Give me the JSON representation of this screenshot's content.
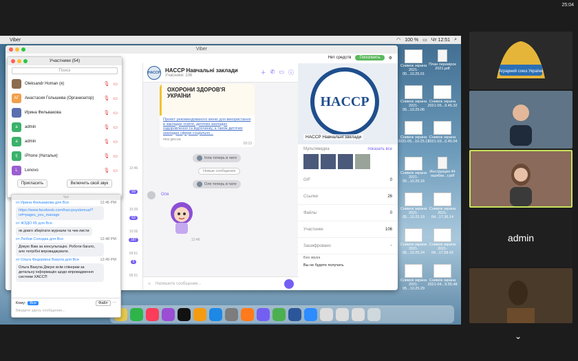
{
  "clock": "25:04",
  "menubar": {
    "app": "Viber",
    "battery": "100 %",
    "time": "Чт 12:51"
  },
  "viber": {
    "window_title": "Viber",
    "top_status": "Нет средств",
    "topup_label": "Пополнить",
    "chat": {
      "name": "HACCP Навчальні заклади",
      "subtitle": "Учасники: 106",
      "post_heading": "ОХОРОНИ ЗДОРОВ'Я УКРАЇНИ",
      "post_link": "Проект рекомендованого меню для використання в закладах освіти, дитячих закладах оздоровлення та відпочинку, а також дитячих закладах сфери соціально...",
      "post_source": "moz.gov.ua",
      "post_time": "09:23",
      "sys1": "Inna теперь в чате",
      "new_messages": "Новые сообщения",
      "sys2": "Оля теперь в чате",
      "sender": "Оля",
      "sticker_time": "12:46",
      "compose_placeholder": "Напишите сообщение..."
    },
    "list_times": [
      "12:46",
      "10:39",
      "10:06",
      "09:51",
      "09:31"
    ],
    "list_badges": [
      "59",
      "63",
      "187",
      "5"
    ],
    "info": {
      "cover_title": "HACCP Навчальні заклади",
      "media_label": "Мультимедиа",
      "show_all": "показать все",
      "gif_label": "GIF",
      "gif_count": "0",
      "links_label": "Ссылки",
      "links_count": "26",
      "files_label": "Файлы",
      "files_count": "0",
      "members_label": "Участники",
      "members_count": "106",
      "encrypted_label": "Зашифровано",
      "mute_label": "Без звука",
      "mute_desc": "Вы не будете получать"
    }
  },
  "participants": {
    "title": "Участники (54)",
    "search_placeholder": "Поиск",
    "items": [
      {
        "name": "Oleksandr Homan (я)",
        "initial": "",
        "color": "#8c6b4f"
      },
      {
        "name": "Анастасия Голышева (Организатор)",
        "initial": "АГ",
        "color": "#f0a04b"
      },
      {
        "name": "Ирина Фильвакова",
        "initial": "",
        "color": "#5b6fb0"
      },
      {
        "name": "admin",
        "initial": "a",
        "color": "#3ab26b"
      },
      {
        "name": "admin",
        "initial": "a",
        "color": "#3ab26b"
      },
      {
        "name": "iPhone (Наталья)",
        "initial": "i(",
        "color": "#3ab26b"
      },
      {
        "name": "Lenovo",
        "initial": "L",
        "color": "#9a5fd0"
      }
    ],
    "invite_label": "Пригласить",
    "unmute_label": "Включить свой звук"
  },
  "zoom_chat": {
    "title": "Чат",
    "messages": [
      {
        "meta": "от Ирина Фильвакова для Все",
        "time": "12:45 PM",
        "text": "https://www.facebook.com/haccpsystemua/?ref=pages_you_manage",
        "link": true
      },
      {
        "meta": "от ЖЗДО 65 для Все",
        "time": "",
        "text": "як довго зберігати журнали та чек-листи",
        "link": false
      },
      {
        "meta": "от Любов Солодка для Все",
        "time": "12:48 PM",
        "text": "Дякую Вам за консультацію. Роботи багато, але потрібні впроваджувати.",
        "link": false
      },
      {
        "meta": "от Ольга Федорівна Вакула для Все",
        "time": "12:49 PM",
        "text": "Ольга Вакула Дякую всім спікерам за детальну інформацію щодо впровадження системи ХАССП",
        "link": false
      }
    ],
    "to_label": "Кому:",
    "to_value": "Все",
    "file_label": "Файл",
    "input_placeholder": "Введите здесь сообщение..."
  },
  "desktop_icons": [
    {
      "label": "Снимок экрана 2021-05...10.25.01"
    },
    {
      "label": "План перевірок 2021.pdf"
    },
    {
      "label": "Снимок экрана 2021-05...10.25.06"
    },
    {
      "label": "Снимок экрана 2021-05...9.45.32"
    },
    {
      "label": "Снимок экрана 2021-05...10.25.11"
    },
    {
      "label": "Снимок экрана 2021-03...0.45.04"
    },
    {
      "label": "Снимок экрана 2021-05...10.25.16"
    },
    {
      "label": "Инструкция 44 ошибки...г.pdf"
    },
    {
      "label": "Снимок экрана 2021-05...10.25.19"
    },
    {
      "label": "Снимок экрана 2021-04...17.36.14"
    },
    {
      "label": "Снимок экрана 2021-05...10.25.24"
    },
    {
      "label": "Снимок экрана 2021-04...17.58.42"
    },
    {
      "label": "Снимок экрана 2021-05...10.25.29"
    },
    {
      "label": "Снимок экрана 2021-04...9.55.48"
    }
  ],
  "videos": {
    "logo_text": "Аграрний союз України",
    "admin_label": "admin"
  }
}
